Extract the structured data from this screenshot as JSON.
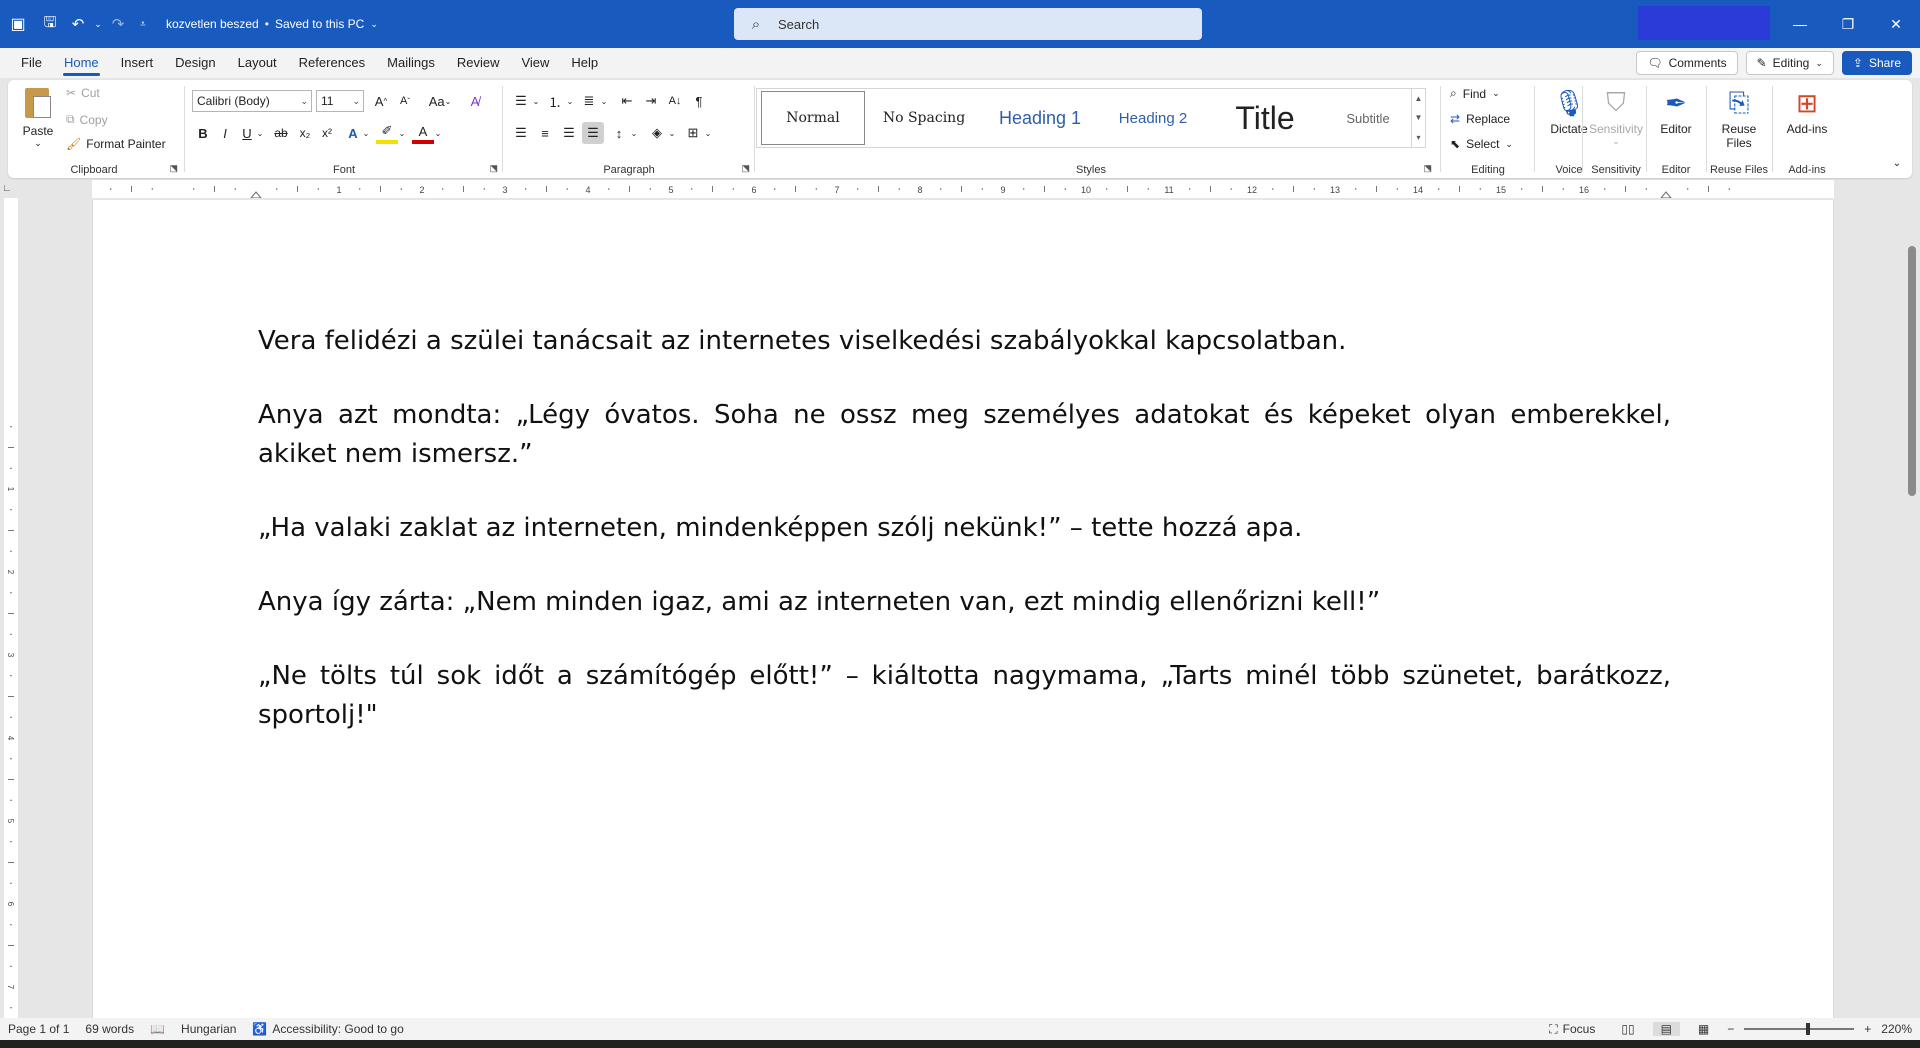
{
  "titlebar": {
    "doc_name": "kozvetlen beszed",
    "save_status": "Saved to this PC",
    "search_placeholder": "Search"
  },
  "menu": {
    "tabs": [
      "File",
      "Home",
      "Insert",
      "Design",
      "Layout",
      "References",
      "Mailings",
      "Review",
      "View",
      "Help"
    ],
    "active": "Home",
    "comments": "Comments",
    "editing": "Editing",
    "share": "Share"
  },
  "ribbon": {
    "clipboard": {
      "paste": "Paste",
      "cut": "Cut",
      "copy": "Copy",
      "format_painter": "Format Painter",
      "label": "Clipboard"
    },
    "font": {
      "name": "Calibri (Body)",
      "size": "11",
      "change_case": "Aa",
      "label": "Font"
    },
    "paragraph": {
      "label": "Paragraph"
    },
    "styles": {
      "label": "Styles",
      "items": [
        "Normal",
        "No Spacing",
        "Heading 1",
        "Heading 2",
        "Title",
        "Subtitle"
      ]
    },
    "editing": {
      "find": "Find",
      "replace": "Replace",
      "select": "Select",
      "label": "Editing"
    },
    "voice": {
      "dictate": "Dictate",
      "label": "Voice"
    },
    "sensitivity": {
      "button": "Sensitivity",
      "label": "Sensitivity"
    },
    "editor": {
      "button": "Editor",
      "label": "Editor"
    },
    "reuse": {
      "button_line1": "Reuse",
      "button_line2": "Files",
      "label": "Reuse Files"
    },
    "addins": {
      "button": "Add-ins",
      "label": "Add-ins"
    }
  },
  "ruler": {
    "numbers": [
      "1",
      "2",
      "3",
      "4",
      "5",
      "6",
      "7",
      "8",
      "9",
      "10",
      "11",
      "12",
      "13",
      "14",
      "15",
      "16"
    ],
    "vnumbers": [
      "1",
      "2",
      "3",
      "4",
      "5",
      "6",
      "7",
      "8"
    ]
  },
  "document": {
    "paragraphs": [
      "Vera felidézi a szülei tanácsait az internetes viselkedési szabályokkal kapcsolatban.",
      "Anya azt mondta: „Légy óvatos. Soha ne ossz meg személyes adatokat és képeket olyan emberekkel, akiket nem ismersz.”",
      "„Ha valaki zaklat az interneten, mindenképpen szólj nekünk!” – tette hozzá apa.",
      "Anya így zárta: „Nem minden igaz, ami az interneten van, ezt mindig ellenőrizni kell!”",
      "„Ne tölts túl sok időt a számítógép előtt!” – kiáltotta nagymama, „Tarts minél több szünetet, barátkozz, sportolj!\""
    ]
  },
  "status": {
    "page": "Page 1 of 1",
    "words": "69 words",
    "language": "Hungarian",
    "accessibility": "Accessibility: Good to go",
    "focus": "Focus",
    "zoom": "220%",
    "zoom_minus": "−",
    "zoom_plus": "+"
  },
  "colors": {
    "brand": "#185abd",
    "account_block": "#2a3bd8"
  }
}
